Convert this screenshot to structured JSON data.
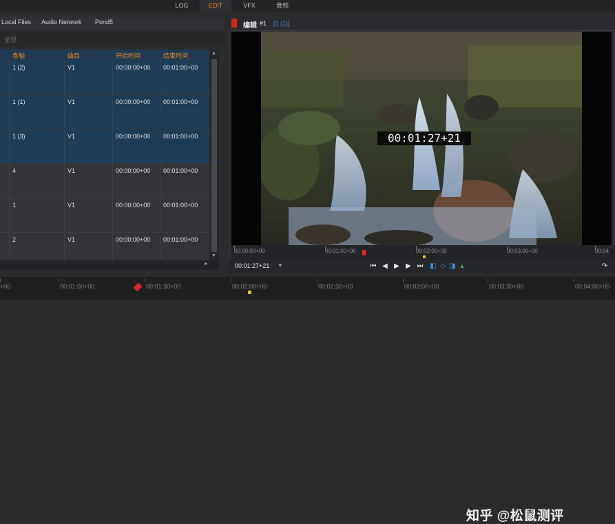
{
  "top_tabs": [
    "LOG",
    "EDIT",
    "VFX",
    "音频"
  ],
  "active_top_tab": "EDIT",
  "source_tabs": [
    "Local Files",
    "Audio Network",
    "Pond5"
  ],
  "filter_placeholder": "呈现",
  "table": {
    "headers": [
      "卷轴",
      "曲目",
      "开始时间",
      "结束时间"
    ],
    "rows": [
      {
        "reel": "1 (2)",
        "track": "V1",
        "start": "00:00:00+00",
        "end": "00:01:00+00",
        "selected": true
      },
      {
        "reel": "1 (1)",
        "track": "V1",
        "start": "00:00:00+00",
        "end": "00:01:00+00",
        "selected": true
      },
      {
        "reel": "1 (3)",
        "track": "V1",
        "start": "00:00:00+00",
        "end": "00:01:00+00",
        "selected": true
      },
      {
        "reel": "4",
        "track": "V1",
        "start": "00:00:00+00",
        "end": "00:01:00+00",
        "selected": false
      },
      {
        "reel": "1",
        "track": "V1",
        "start": "00:00:00+00",
        "end": "00:01:00+00",
        "selected": false
      },
      {
        "reel": "2",
        "track": "V1",
        "start": "00:00:00+00",
        "end": "00:01:00+00",
        "selected": false
      }
    ]
  },
  "viewer": {
    "title": "编辑",
    "number": "#1",
    "info": "[1 (1)]",
    "overlay_timecode": "00:01:27+21",
    "ruler_ticks": [
      "00:00:00+00",
      "00:01:00+00",
      "00:02:00+00",
      "00:03:00+00",
      "00:04"
    ],
    "current_timecode": "00:01:27+21"
  },
  "watermark": "知乎 @松鼠测评",
  "timeline_ticks": [
    "+00",
    "00:01:00+00",
    "00:01:30+00",
    "00:02:00+00",
    "00:02:30+00",
    "00:03:00+00",
    "00:03:30+00",
    "00:04:00+00"
  ],
  "colors": {
    "accent_orange": "#f08a24",
    "selection_blue": "#1c3d57",
    "playhead_red": "#e0262a",
    "info_blue": "#4f8fd6"
  }
}
